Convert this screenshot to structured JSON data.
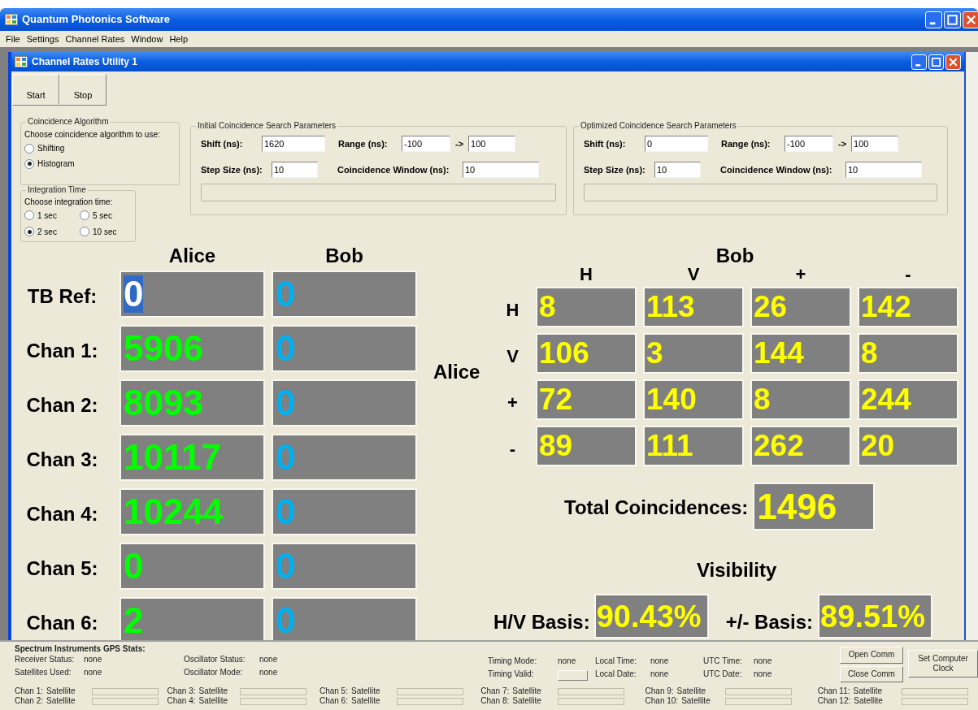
{
  "app": {
    "title": "Quantum Photonics Software"
  },
  "menu": [
    "File",
    "Settings",
    "Channel Rates",
    "Window",
    "Help"
  ],
  "child_window": {
    "title": "Channel Rates Utility 1"
  },
  "buttons": [
    "Start",
    "Stop"
  ],
  "coincidence_algorithm": {
    "title": "Coincidence Algorithm",
    "prompt": "Choose coincidence algorithm to use:",
    "options": [
      {
        "label": "Shifting",
        "selected": false
      },
      {
        "label": "Histogram",
        "selected": true
      }
    ]
  },
  "integration_time": {
    "title": "Integration Time",
    "prompt": "Choose integration time:",
    "options": [
      {
        "label": "1 sec",
        "selected": false
      },
      {
        "label": "5 sec",
        "selected": false
      },
      {
        "label": "2 sec",
        "selected": true
      },
      {
        "label": "10 sec",
        "selected": false
      }
    ]
  },
  "search_params": [
    {
      "title": "Initial Coincidence Search Parameters",
      "shift_label": "Shift (ns):",
      "shift": "1620",
      "range_label": "Range (ns):",
      "range_from": "-100",
      "arrow": "->",
      "range_to": "100",
      "step_label": "Step Size (ns):",
      "step": "10",
      "window_label": "Coincidence Window (ns):",
      "window": "10",
      "level": 0
    },
    {
      "title": "Optimized Coincidence Search Parameters",
      "shift_label": "Shift (ns):",
      "shift": "0",
      "range_label": "Range (ns):",
      "range_from": "-100",
      "arrow": "->",
      "range_to": "100",
      "step_label": "Step Size (ns):",
      "step": "10",
      "window_label": "Coincidence Window (ns):",
      "window": "10",
      "level": 0
    }
  ],
  "channel_rates": {
    "headers": [
      "Alice",
      "Bob"
    ],
    "rows": [
      {
        "label": "TB Ref:",
        "alice": "0",
        "bob": "0",
        "alice_selected": true
      },
      {
        "label": "Chan 1:",
        "alice": "5906",
        "bob": "0",
        "alice_selected": false
      },
      {
        "label": "Chan 2:",
        "alice": "8093",
        "bob": "0",
        "alice_selected": false
      },
      {
        "label": "Chan 3:",
        "alice": "10117",
        "bob": "0",
        "alice_selected": false
      },
      {
        "label": "Chan 4:",
        "alice": "10244",
        "bob": "0",
        "alice_selected": false
      },
      {
        "label": "Chan 5:",
        "alice": "0",
        "bob": "0",
        "alice_selected": false
      },
      {
        "label": "Chan 6:",
        "alice": "2",
        "bob": "0",
        "alice_selected": false
      }
    ]
  },
  "coincidence_matrix": {
    "row_group": "Alice",
    "column_group": "Bob",
    "columns": [
      "H",
      "V",
      "+",
      "-"
    ],
    "rows": [
      {
        "label": "H",
        "values": [
          "8",
          "113",
          "26",
          "142"
        ]
      },
      {
        "label": "V",
        "values": [
          "106",
          "3",
          "144",
          "8"
        ]
      },
      {
        "label": "+",
        "values": [
          "72",
          "140",
          "8",
          "244"
        ]
      },
      {
        "label": "-",
        "values": [
          "89",
          "111",
          "262",
          "20"
        ]
      }
    ]
  },
  "total": {
    "label": "Total Coincidences:",
    "value": "1496"
  },
  "visibility": {
    "title": "Visibility",
    "items": [
      {
        "label": "H/V Basis:",
        "value": "90.43%"
      },
      {
        "label": "+/- Basis:",
        "value": "89.51%"
      }
    ]
  },
  "gps": {
    "title": "Spectrum Instruments GPS Stats:",
    "columns": [
      [
        {
          "label": "Receiver Status:",
          "value": "none"
        },
        {
          "label": "Satellites Used:",
          "value": "none"
        }
      ],
      [
        {
          "label": "Oscillator Status:",
          "value": "none"
        },
        {
          "label": "Oscillator Mode:",
          "value": "none"
        }
      ],
      [
        {
          "label": "Timing Mode:",
          "value": "none"
        },
        {
          "label": "Timing Valid:",
          "kind": "indicator"
        }
      ],
      [
        {
          "label": "Local Time:",
          "value": "none"
        },
        {
          "label": "Local Date:",
          "value": "none"
        }
      ],
      [
        {
          "label": "UTC Time:",
          "value": "none"
        },
        {
          "label": "UTC Date:",
          "value": "none"
        }
      ]
    ],
    "comm_buttons": [
      "Open Comm",
      "Close Comm"
    ],
    "clock_button": "Set Computer Clock",
    "channels": [
      {
        "chan": "Chan 1:",
        "label": "Satellite",
        "level": 0
      },
      {
        "chan": "Chan 2:",
        "label": "Satellite",
        "level": 0
      },
      {
        "chan": "Chan 3:",
        "label": "Satellite",
        "level": 0
      },
      {
        "chan": "Chan 4:",
        "label": "Satellite",
        "level": 0
      },
      {
        "chan": "Chan 5:",
        "label": "Satellite",
        "level": 0
      },
      {
        "chan": "Chan 6:",
        "label": "Satellite",
        "level": 0
      },
      {
        "chan": "Chan 7:",
        "label": "Satellite",
        "level": 0
      },
      {
        "chan": "Chan 8:",
        "label": "Satellite",
        "level": 0
      },
      {
        "chan": "Chan 9:",
        "label": "Satellite",
        "level": 0
      },
      {
        "chan": "Chan 10:",
        "label": "Satellite",
        "level": 0
      },
      {
        "chan": "Chan 11:",
        "label": "Satellite",
        "level": 0
      },
      {
        "chan": "Chan 12:",
        "label": "Satellite",
        "level": 0
      }
    ]
  }
}
